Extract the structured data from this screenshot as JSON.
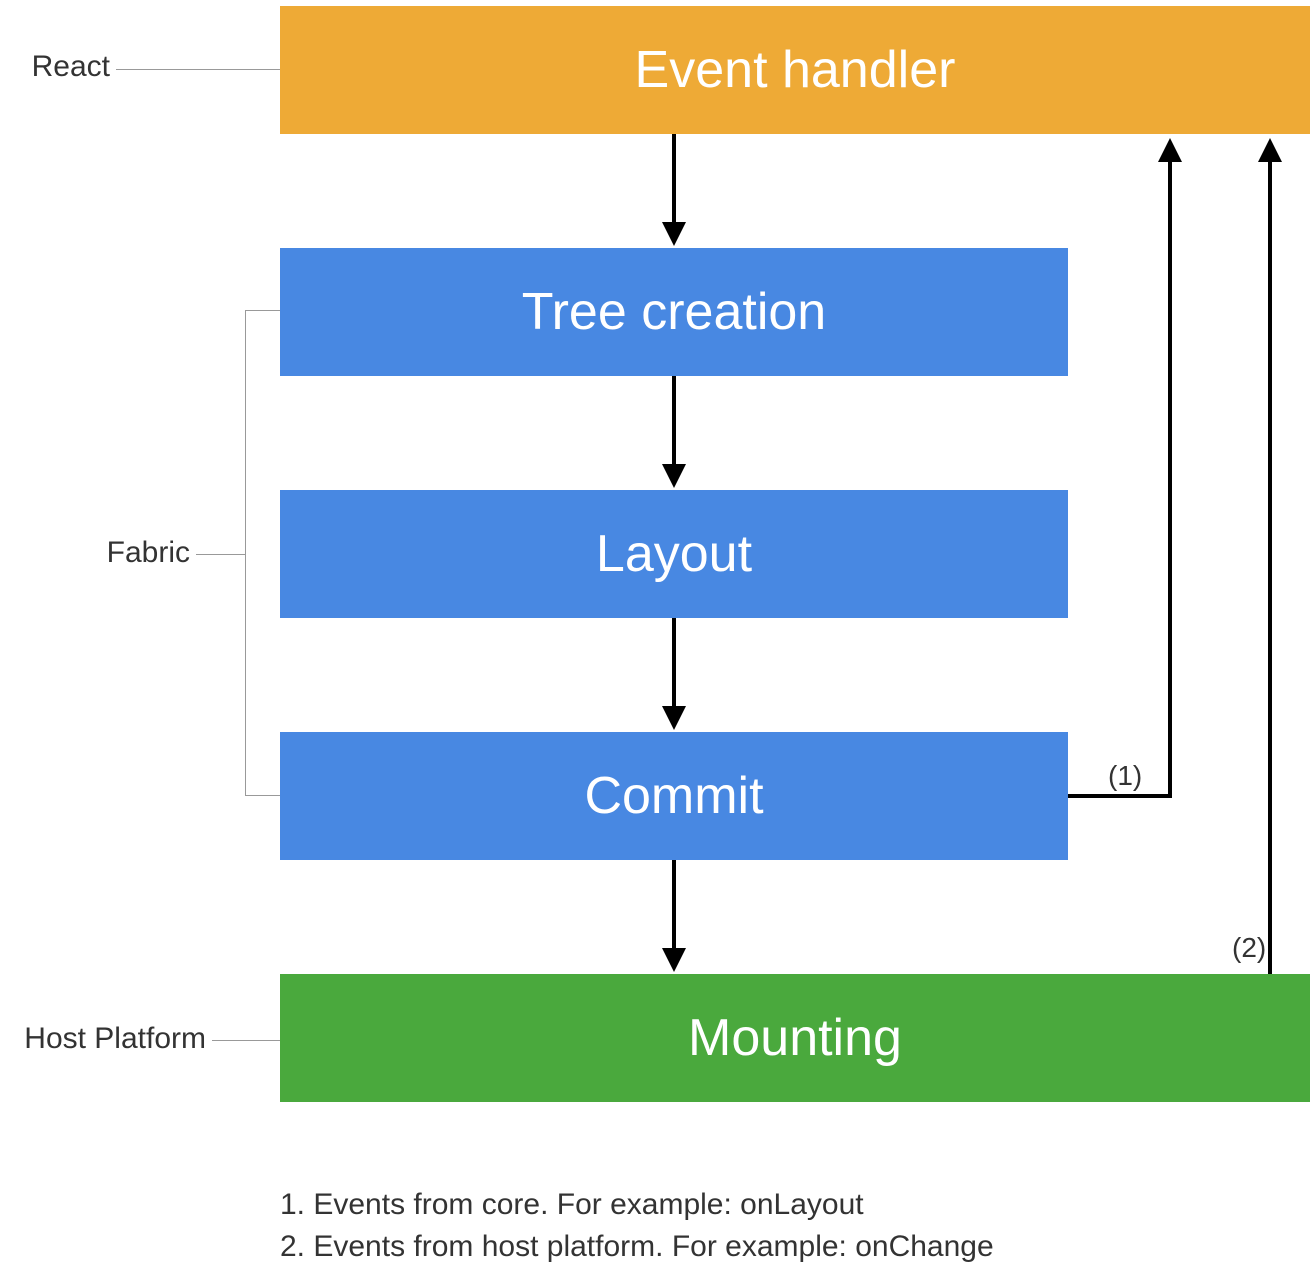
{
  "diagram": {
    "boxes": {
      "event_handler": "Event handler",
      "tree_creation": "Tree creation",
      "layout": "Layout",
      "commit": "Commit",
      "mounting": "Mounting"
    },
    "categories": {
      "react": "React",
      "fabric": "Fabric",
      "host_platform": "Host Platform"
    },
    "annotations": {
      "note1_short": "(1)",
      "note2_short": "(2)"
    },
    "footnotes": {
      "line1": "1. Events from core. For example: onLayout",
      "line2": "2. Events from host platform. For example: onChange"
    },
    "colors": {
      "orange": "#eeaa36",
      "blue": "#4888e2",
      "green": "#4aa93d"
    }
  },
  "chart_data": {
    "type": "flowchart",
    "nodes": [
      {
        "id": "event_handler",
        "label": "Event handler",
        "group": "React",
        "color": "orange"
      },
      {
        "id": "tree_creation",
        "label": "Tree creation",
        "group": "Fabric",
        "color": "blue"
      },
      {
        "id": "layout",
        "label": "Layout",
        "group": "Fabric",
        "color": "blue"
      },
      {
        "id": "commit",
        "label": "Commit",
        "group": "Fabric",
        "color": "blue"
      },
      {
        "id": "mounting",
        "label": "Mounting",
        "group": "Host Platform",
        "color": "green"
      }
    ],
    "edges": [
      {
        "from": "event_handler",
        "to": "tree_creation"
      },
      {
        "from": "tree_creation",
        "to": "layout"
      },
      {
        "from": "layout",
        "to": "commit"
      },
      {
        "from": "commit",
        "to": "mounting"
      },
      {
        "from": "commit",
        "to": "event_handler",
        "label": "(1)",
        "note": "Events from core. For example: onLayout"
      },
      {
        "from": "mounting",
        "to": "event_handler",
        "label": "(2)",
        "note": "Events from host platform. For example: onChange"
      }
    ],
    "groups": [
      "React",
      "Fabric",
      "Host Platform"
    ]
  }
}
